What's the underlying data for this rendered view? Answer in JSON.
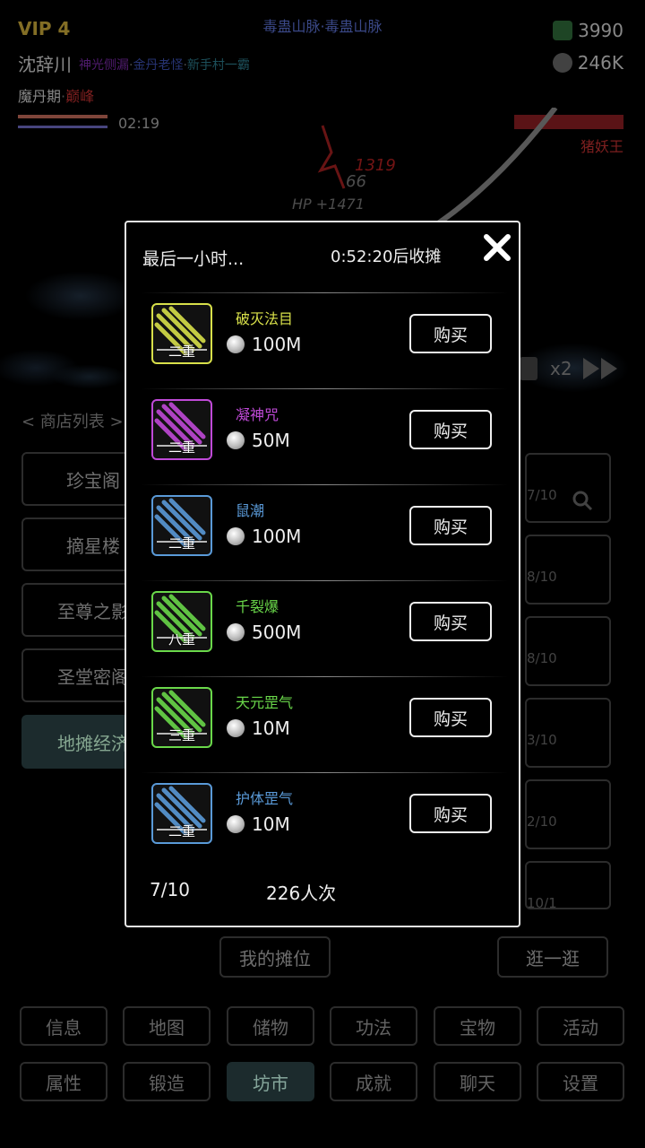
{
  "hud": {
    "vip": "VIP 4",
    "location": "毒蛊山脉·毒蛊山脉",
    "player_name": "沈辞川",
    "titles": [
      {
        "text": "神光侧漏",
        "color": "#7a2aa8"
      },
      {
        "text": "·",
        "color": "#777777"
      },
      {
        "text": "金丹老怪",
        "color": "#3b4fb0"
      },
      {
        "text": "·",
        "color": "#777777"
      },
      {
        "text": "新手村一霸",
        "color": "#2c7a8a"
      }
    ],
    "realm": "魔丹期",
    "realm_stage": "巅峰",
    "spirit_stones": "3990",
    "silver": "246K",
    "timer": "02:19",
    "boss_name": "猪妖王",
    "damage_texts": [
      "1319",
      "66",
      "HP +1471"
    ],
    "speed": "x2"
  },
  "shop": {
    "list_header": "< 商店列表 >",
    "stores": [
      "珍宝阁",
      "摘星楼",
      "至尊之影",
      "圣堂密阁",
      "地摊经济"
    ],
    "slots": [
      "7/10",
      "8/10",
      "8/10",
      "3/10",
      "2/10",
      "10/1"
    ],
    "my_stall": "我的摊位",
    "browse": "逛一逛"
  },
  "nav": {
    "row1": [
      "信息",
      "地图",
      "储物",
      "功法",
      "宝物",
      "活动"
    ],
    "row2": [
      "属性",
      "锻造",
      "坊市",
      "成就",
      "聊天",
      "设置"
    ]
  },
  "modal": {
    "title": "最后一小时...",
    "countdown": "0:52:20后收摊",
    "buy_label": "购买",
    "items": [
      {
        "name": "破灭法目",
        "tier": "二重",
        "price": "100M",
        "color": "#d8e04a"
      },
      {
        "name": "凝神咒",
        "tier": "二重",
        "price": "50M",
        "color": "#c04ad8"
      },
      {
        "name": "鼠潮",
        "tier": "二重",
        "price": "100M",
        "color": "#5a9ad8"
      },
      {
        "name": "千裂爆",
        "tier": "八重",
        "price": "500M",
        "color": "#6ad84a"
      },
      {
        "name": "天元罡气",
        "tier": "三重",
        "price": "10M",
        "color": "#6ad84a"
      },
      {
        "name": "护体罡气",
        "tier": "二重",
        "price": "10M",
        "color": "#5a9ad8"
      }
    ],
    "stock": "7/10",
    "visitors": "226人次"
  },
  "colors": {
    "accent_teal": "#2b4245",
    "boss_red": "#c03030",
    "vip_gold": "#caa93a"
  }
}
